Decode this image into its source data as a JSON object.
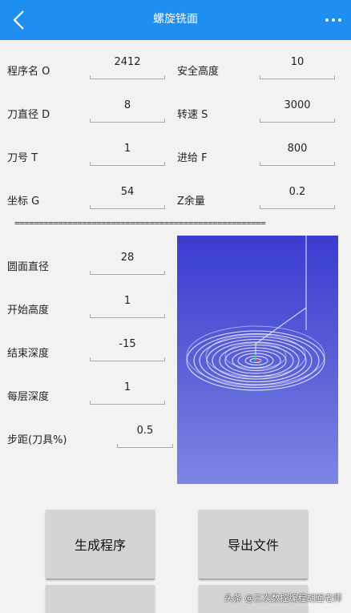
{
  "appbar": {
    "title": "螺旋铣面",
    "back_icon": "chevron-left-icon",
    "more_icon": "more-dots-icon"
  },
  "params_top": [
    {
      "label": "程序名 O",
      "value": "2412"
    },
    {
      "label": "安全高度",
      "value": "10"
    },
    {
      "label": "刀直径 D",
      "value": "8"
    },
    {
      "label": "转速 S",
      "value": "3000"
    },
    {
      "label": "刀号 T",
      "value": "1"
    },
    {
      "label": "进给 F",
      "value": "800"
    },
    {
      "label": "坐标 G",
      "value": "54"
    },
    {
      "label": "Z余量",
      "value": "0.2"
    }
  ],
  "divider": "====================================================",
  "params_bottom": [
    {
      "label": "圆面直径",
      "value": "28"
    },
    {
      "label": "开始高度",
      "value": "1"
    },
    {
      "label": "结束深度",
      "value": "-15"
    },
    {
      "label": "每层深度",
      "value": "1"
    },
    {
      "label": "步距(刀具%)",
      "value": "0.5"
    }
  ],
  "buttons": {
    "generate": "生成程序",
    "export": "导出文件"
  },
  "watermark": "头条 @三次数控编程胡面老师",
  "colors": {
    "accent": "#1e8ff0",
    "preview_top": "#3a3cd0",
    "preview_bottom": "#7d86e6"
  }
}
